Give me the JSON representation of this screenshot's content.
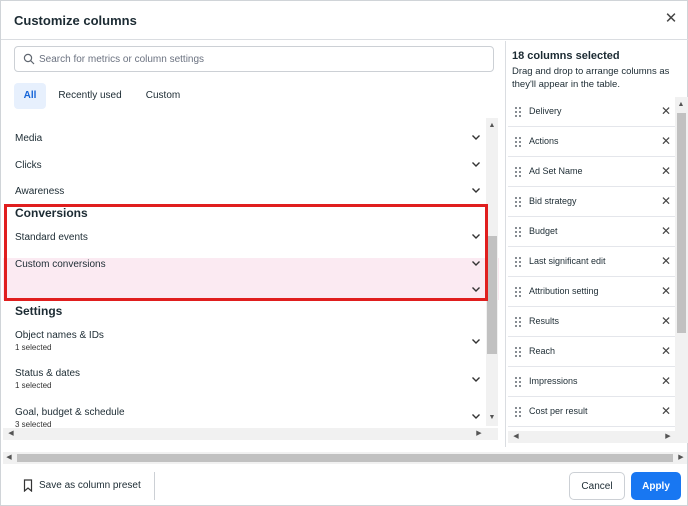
{
  "dialog": {
    "title": "Customize columns",
    "close_icon": "close-icon"
  },
  "search": {
    "placeholder": "Search for metrics or column settings"
  },
  "tabs": [
    {
      "label": "All",
      "active": true
    },
    {
      "label": "Recently used",
      "active": false
    },
    {
      "label": "Custom",
      "active": false
    }
  ],
  "categories": {
    "media": "Media",
    "clicks": "Clicks",
    "awareness": "Awareness",
    "conversions_title": "Conversions",
    "standard_events": "Standard events",
    "custom_conversions": "Custom conversions",
    "settings_title": "Settings",
    "object_names": {
      "label": "Object names & IDs",
      "sub": "1 selected"
    },
    "status_dates": {
      "label": "Status & dates",
      "sub": "1 selected"
    },
    "goal_budget": {
      "label": "Goal, budget & schedule",
      "sub": "3 selected"
    }
  },
  "selected_panel": {
    "title": "18 columns selected",
    "description": "Drag and drop to arrange columns as they'll appear in the table.",
    "columns": [
      "Delivery",
      "Actions",
      "Ad Set Name",
      "Bid strategy",
      "Budget",
      "Last significant edit",
      "Attribution setting",
      "Results",
      "Reach",
      "Impressions",
      "Cost per result"
    ]
  },
  "footer": {
    "save_preset_label": "Save as column preset",
    "cancel_label": "Cancel",
    "apply_label": "Apply"
  },
  "colors": {
    "accent": "#1877f2",
    "highlight": "#e01e1e",
    "active_tab_bg": "#e7f0fd"
  }
}
